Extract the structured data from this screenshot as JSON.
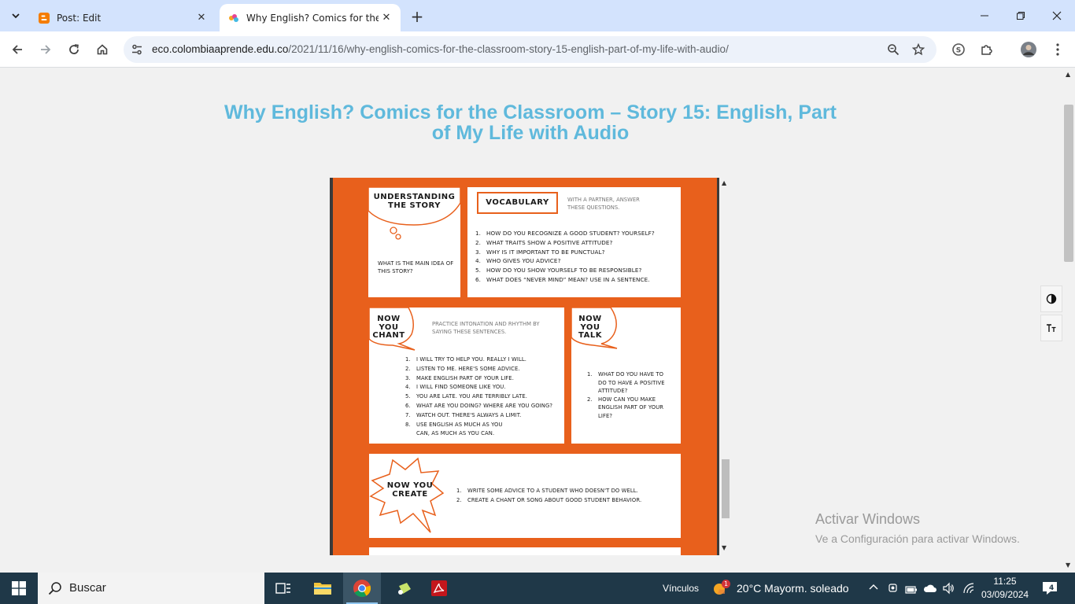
{
  "browser": {
    "tabs": [
      {
        "title": "Post: Edit",
        "active": false
      },
      {
        "title": "Why English? Comics for the Cl",
        "active": true
      }
    ],
    "url_domain": "eco.colombiaaprende.edu.co",
    "url_path": "/2021/11/16/why-english-comics-for-the-classroom-story-15-english-part-of-my-life-with-audio/"
  },
  "page": {
    "title": "Why English? Comics for the Classroom – Story 15: English, Part of My Life with Audio"
  },
  "comic": {
    "understanding": {
      "heading": "UNDERSTANDING THE STORY",
      "question": "WHAT IS THE MAIN IDEA OF THIS STORY?"
    },
    "vocabulary": {
      "heading": "VOCABULARY",
      "hint": "WITH A PARTNER, ANSWER THESE QUESTIONS.",
      "items": [
        "HOW DO YOU RECOGNIZE A GOOD STUDENT? YOURSELF?",
        "WHAT TRAITS SHOW A POSITIVE ATTITUDE?",
        "WHY IS IT IMPORTANT TO BE PUNCTUAL?",
        "WHO GIVES YOU ADVICE?",
        "HOW DO YOU SHOW YOURSELF TO BE RESPONSIBLE?",
        "WHAT DOES “NEVER MIND” MEAN? USE IN A SENTENCE."
      ]
    },
    "chant": {
      "heading": "NOW YOU CHANT",
      "hint": "PRACTICE INTONATION AND RHYTHM BY SAYING THESE SENTENCES.",
      "items": [
        "I WILL TRY TO HELP YOU. REALLY I WILL.",
        "LISTEN TO ME. HERE'S SOME ADVICE.",
        "MAKE ENGLISH PART OF YOUR LIFE.",
        "I WILL FIND SOMEONE LIKE YOU.",
        "YOU ARE LATE. YOU ARE TERRIBLY LATE.",
        "WHAT ARE YOU DOING? WHERE ARE YOU GOING?",
        "WATCH OUT. THERE'S ALWAYS A LIMIT.",
        "USE ENGLISH AS MUCH AS YOU CAN, AS MUCH AS YOU CAN."
      ]
    },
    "talk": {
      "heading": "NOW YOU TALK",
      "items": [
        "WHAT DO YOU HAVE TO DO TO HAVE A POSITIVE ATTITUDE?",
        "HOW CAN YOU MAKE ENGLISH PART OF YOUR LIFE?"
      ]
    },
    "create": {
      "heading": "NOW YOU CREATE",
      "items": [
        "WRITE SOME ADVICE TO A STUDENT WHO DOESN'T DO WELL.",
        "CREATE A CHANT OR SONG ABOUT GOOD STUDENT BEHAVIOR."
      ]
    }
  },
  "watermark": {
    "title": "Activar Windows",
    "subtitle": "Ve a Configuración para activar Windows."
  },
  "taskbar": {
    "search_placeholder": "Buscar",
    "links_label": "Vínculos",
    "weather": "20°C  Mayorm. soleado",
    "weather_badge": "1",
    "time": "11:25",
    "date": "03/09/2024",
    "notifications": "4"
  },
  "colors": {
    "accent_title": "#5fb9dc",
    "comic_orange": "#e8601c",
    "tab_strip": "#d3e3fd",
    "taskbar": "#1f3848"
  }
}
